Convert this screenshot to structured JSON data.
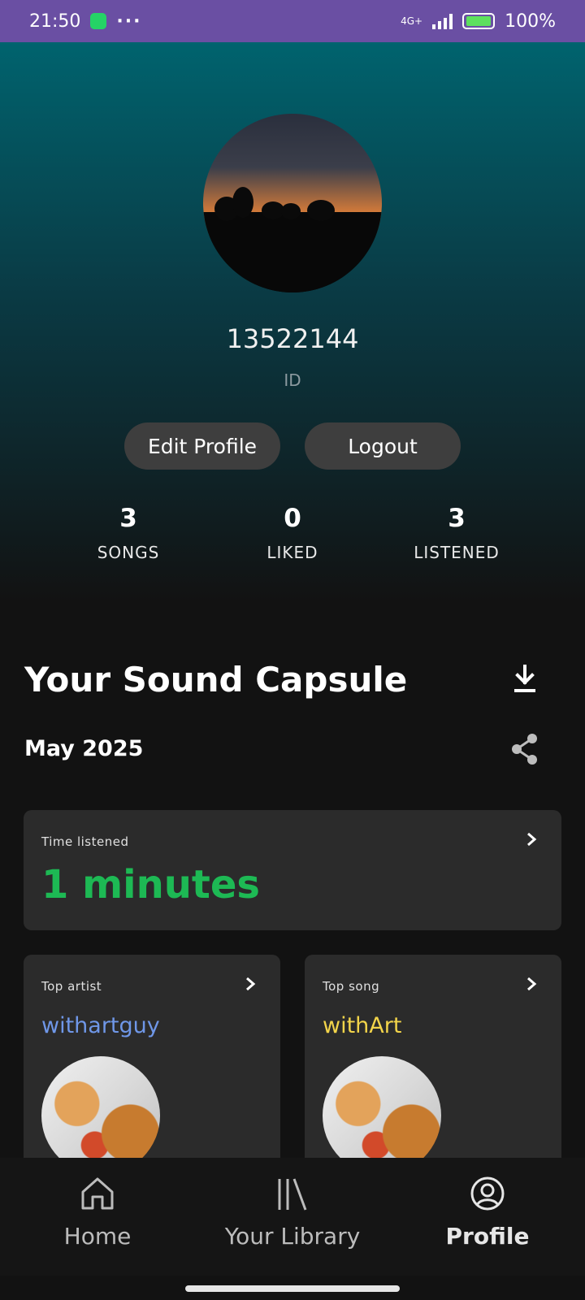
{
  "status_bar": {
    "time": "21:50",
    "network": "4G+",
    "battery": "100%"
  },
  "profile": {
    "username": "13522144",
    "id_label": "ID",
    "edit_button": "Edit Profile",
    "logout_button": "Logout",
    "stats": [
      {
        "value": "3",
        "label": "SONGS"
      },
      {
        "value": "0",
        "label": "LIKED"
      },
      {
        "value": "3",
        "label": "LISTENED"
      }
    ]
  },
  "capsule": {
    "title": "Your Sound Capsule",
    "month": "May 2025",
    "time_listened": {
      "label": "Time listened",
      "value": "1 minutes"
    },
    "top_artist": {
      "label": "Top artist",
      "name": "withartguy"
    },
    "top_song": {
      "label": "Top song",
      "name": "withArt"
    }
  },
  "nav": {
    "items": [
      {
        "label": "Home",
        "icon": "home-icon"
      },
      {
        "label": "Your Library",
        "icon": "library-icon"
      },
      {
        "label": "Profile",
        "icon": "profile-icon",
        "active": true
      }
    ]
  },
  "colors": {
    "accent_green": "#1db954",
    "artist_blue": "#6f97e8",
    "song_yellow": "#f2d44a",
    "status_bar": "#6a4fa3"
  }
}
